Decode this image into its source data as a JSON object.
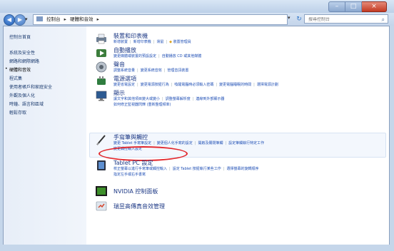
{
  "window": {
    "min": "–",
    "max": "□",
    "close": "×"
  },
  "nav": {
    "back": "◀",
    "forward": "▶",
    "history_drop": "▾",
    "breadcrumb": [
      "控制台",
      "▸",
      "硬體和音效",
      "▸"
    ],
    "addr_drop": "▾",
    "refresh": "↻",
    "search_placeholder": "搜尋控制台",
    "search_icon": "⌕"
  },
  "sidebar": {
    "items": [
      "控制台首頁",
      "系統及安全性",
      "網路和網際網路",
      "硬體和音效",
      "程式集",
      "使用者帳戶和家庭安全",
      "外觀及個人化",
      "時鐘、語言和區域",
      "輕鬆存取"
    ],
    "current_bullet": "•"
  },
  "categories": {
    "devices": {
      "title": "裝置和印表機",
      "links": [
        "新增裝置",
        "新增印表機",
        "滑鼠",
        "裝置管理員"
      ]
    },
    "autoplay": {
      "title": "自動播放",
      "links": [
        "變更媒體或裝置的預設設定",
        "自動播放 CD 或其他媒體"
      ]
    },
    "sound": {
      "title": "聲音",
      "links": [
        "調整系統音量",
        "變更系統音效",
        "管理音訊裝置"
      ]
    },
    "power": {
      "title": "電源選項",
      "links": [
        "變更省電設定",
        "變更電源按鈕行為",
        "喚醒電腦時必須輸入密碼",
        "變更電腦睡眠的時間",
        "選擇電源計劃"
      ]
    },
    "display": {
      "title": "顯示",
      "links": [
        "讓文字和其他項目變大或變小",
        "調整螢幕解析度",
        "連線到外部顯示器"
      ],
      "links2": [
        "如何修正監視器閃爍 (重新整理頻率)"
      ]
    },
    "pen": {
      "title": "手寫筆與觸控",
      "links": [
        "變更 Tablet 手寫筆設定",
        "變更個人化手寫的設定",
        "開啟及關閉筆觸",
        "設定筆觸執行特定工作"
      ],
      "links2": [
        "變更觸控輸入設定"
      ]
    },
    "tablet": {
      "title": "Tablet PC 設定",
      "links": [
        "校正螢幕以進行手寫筆或觸控輸入",
        "設定 Tablet 按鈕執行某些工作",
        "選擇螢幕的旋轉順序"
      ],
      "links2": [
        "指定左手或右手書寫"
      ]
    },
    "nvidia": {
      "title": "NVIDIA 控制面板"
    },
    "realtek": {
      "title": "瑞昱高傳真音效管理"
    }
  },
  "colors": {
    "annotation_ellipse": "#e2262b",
    "link": "#1f4fb5",
    "title": "#1e3a86"
  }
}
